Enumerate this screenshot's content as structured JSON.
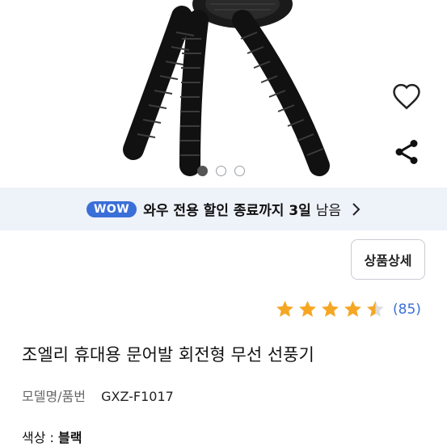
{
  "carousel": {
    "page_count": 3,
    "active_index": 0
  },
  "actions": {
    "wishlist_icon": "heart-icon",
    "share_icon": "share-icon"
  },
  "promo": {
    "badge": "WOW",
    "text": "와우 전용 할인 종료까지 3일",
    "suffix": "남음"
  },
  "detail_button_label": "상품상세",
  "rating": {
    "stars": 4.5,
    "count": "(85)",
    "color": "#f5a623"
  },
  "product": {
    "title": "조엘리 휴대용 문어발 회전형 무선 선풍기",
    "model_label": "모델명/품번",
    "model_value": "GXZ-F1017",
    "color_label": "색상 : ",
    "color_value": "블랙"
  }
}
